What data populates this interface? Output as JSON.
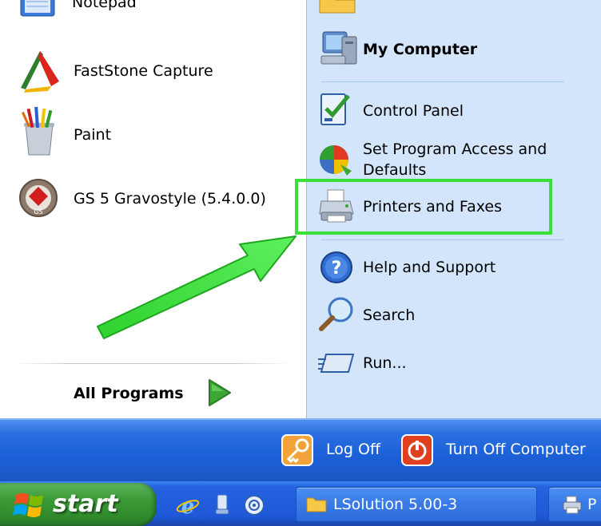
{
  "left_menu": {
    "items": [
      {
        "label": "Notepad"
      },
      {
        "label": "FastStone Capture"
      },
      {
        "label": "Paint"
      },
      {
        "label": "GS 5 Gravostyle (5.4.0.0)"
      }
    ],
    "all_programs_label": "All Programs"
  },
  "right_menu": {
    "my_computer": "My Computer",
    "control_panel": "Control Panel",
    "set_program_access": "Set Program Access and",
    "set_program_access_2": "Defaults",
    "printers_faxes": "Printers and Faxes",
    "help_support": "Help and Support",
    "search": "Search",
    "run": "Run..."
  },
  "footer": {
    "log_off": "Log Off",
    "turn_off": "Turn Off Computer"
  },
  "taskbar": {
    "start": "start",
    "task_lsolution": "LSolution 5.00-3",
    "task_partial": "P"
  },
  "colors": {
    "highlight_box": "#39e039",
    "arrow": "#39e039",
    "right_pane": "#d3e5fa",
    "start_green": "#3a9a36",
    "taskbar_blue": "#2463e0"
  }
}
